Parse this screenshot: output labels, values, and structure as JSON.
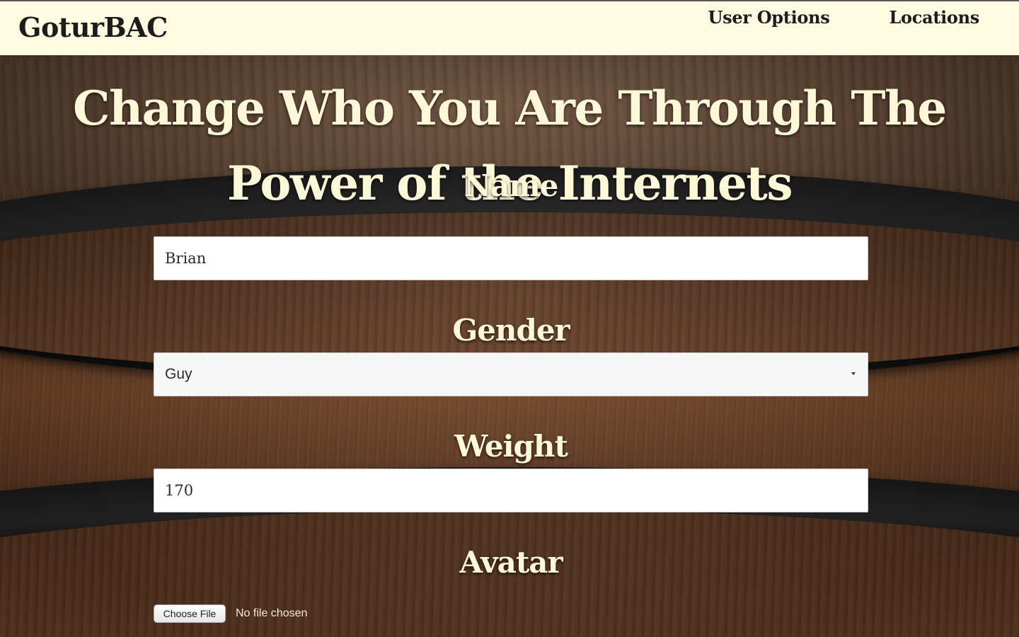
{
  "navbar": {
    "brand": "GoturBAC",
    "links": [
      {
        "label": "User Options"
      },
      {
        "label": "Locations"
      }
    ]
  },
  "page": {
    "title": "Change Who You Are Through The Power of the Internets"
  },
  "form": {
    "name": {
      "label": "Name",
      "value": "Brian"
    },
    "gender": {
      "label": "Gender",
      "selected": "Guy"
    },
    "weight": {
      "label": "Weight",
      "value": "170"
    },
    "avatar": {
      "label": "Avatar",
      "button": "Choose File",
      "status": "No file chosen"
    }
  },
  "colors": {
    "navbar_bg": "#fefbe3",
    "heading_text": "#fdf8d8",
    "nav_text": "#1c1c1c"
  }
}
